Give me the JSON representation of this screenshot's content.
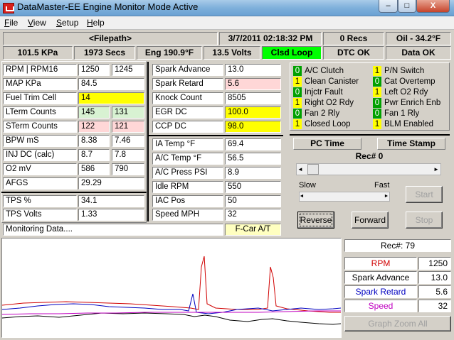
{
  "window": {
    "title": "DataMaster-EE Engine Monitor Mode Active",
    "minimize": "–",
    "maximize": "□",
    "close": "X"
  },
  "menu": [
    {
      "first": "F",
      "rest": "ile"
    },
    {
      "first": "V",
      "rest": "iew"
    },
    {
      "first": "S",
      "rest": "etup"
    },
    {
      "first": "H",
      "rest": "elp"
    }
  ],
  "status1": {
    "filepath": "<Filepath>",
    "datetime": "3/7/2011  02:18:32 PM",
    "recs": "0 Recs",
    "oil": "Oil - 34.2°F"
  },
  "status2": {
    "baro": "101.5 KPa",
    "secs": "1973 Secs",
    "eng": "Eng  190.9°F",
    "volts": "13.5 Volts",
    "loop": "Clsd Loop",
    "dtc": "DTC OK",
    "data": "Data OK"
  },
  "left": [
    {
      "label": "RPM  |  RPM16",
      "v1": "1250",
      "v2": "1245"
    },
    {
      "label": "MAP KPa",
      "v1": "84.5"
    },
    {
      "label": "Fuel Trim Cell",
      "v1": "14"
    },
    {
      "label": "LTerm Counts",
      "v1": "145",
      "v2": "131"
    },
    {
      "label": "STerm Counts",
      "v1": "122",
      "v2": "121"
    },
    {
      "label": "BPW  mS",
      "v1": "8.38",
      "v2": "7.46"
    },
    {
      "label": "INJ DC (calc)",
      "v1": "8.7",
      "v2": "7.8"
    },
    {
      "label": "O2 mV",
      "v1": "586",
      "v2": "790"
    },
    {
      "label": "AFGS",
      "v1": "29.29"
    },
    {
      "label": "TPS %",
      "v1": "34.1"
    },
    {
      "label": "TPS Volts",
      "v1": "1.33"
    }
  ],
  "mid": [
    {
      "label": "Spark Advance",
      "v": "13.0"
    },
    {
      "label": "Spark Retard",
      "v": "5.6"
    },
    {
      "label": "Knock Count",
      "v": "8505"
    },
    {
      "label": "EGR DC",
      "v": "100.0"
    },
    {
      "label": "CCP DC",
      "v": "98.0"
    },
    {
      "label": "IA Temp °F",
      "v": "69.4"
    },
    {
      "label": "A/C Temp °F",
      "v": "56.5"
    },
    {
      "label": "A/C Press PSI",
      "v": "8.9"
    },
    {
      "label": "Idle RPM",
      "v": "550"
    },
    {
      "label": "IAC Pos",
      "v": "50"
    },
    {
      "label": "Speed MPH",
      "v": "32"
    }
  ],
  "monitoring": "Monitoring Data....",
  "car": "F-Car A/T",
  "flags_left": [
    {
      "v": "0",
      "label": "A/C Clutch"
    },
    {
      "v": "1",
      "label": "Clean Canister"
    },
    {
      "v": "0",
      "label": "Injctr Fault"
    },
    {
      "v": "1",
      "label": "Right O2 Rdy"
    },
    {
      "v": "0",
      "label": "Fan 2 Rly"
    },
    {
      "v": "1",
      "label": "Closed Loop"
    }
  ],
  "flags_right": [
    {
      "v": "1",
      "label": "P/N Switch"
    },
    {
      "v": "0",
      "label": "Cat Overtemp"
    },
    {
      "v": "1",
      "label": "Left O2 Rdy"
    },
    {
      "v": "0",
      "label": "Pwr Enrich Enb"
    },
    {
      "v": "0",
      "label": "Fan 1 Rly"
    },
    {
      "v": "1",
      "label": "BLM Enabled"
    }
  ],
  "playback": {
    "tab_pc": "PC Time",
    "tab_stamp": "Time Stamp",
    "rec": "Rec# 0",
    "slow": "Slow",
    "fast": "Fast",
    "start": "Start",
    "reverse": "Reverse",
    "forward": "Forward",
    "stop": "Stop",
    "left_arrow": "◄",
    "right_arrow": "►"
  },
  "graph_legend": {
    "rec": "Rec#:  79",
    "items": [
      {
        "label": "RPM",
        "value": "1250",
        "color": "#d00000"
      },
      {
        "label": "Spark Advance",
        "value": "13.0",
        "color": "#000000"
      },
      {
        "label": "Spark Retard",
        "value": "5.6",
        "color": "#0000c0"
      },
      {
        "label": "Speed",
        "value": "32",
        "color": "#c000c0"
      }
    ],
    "zoom": "Graph Zoom All"
  }
}
